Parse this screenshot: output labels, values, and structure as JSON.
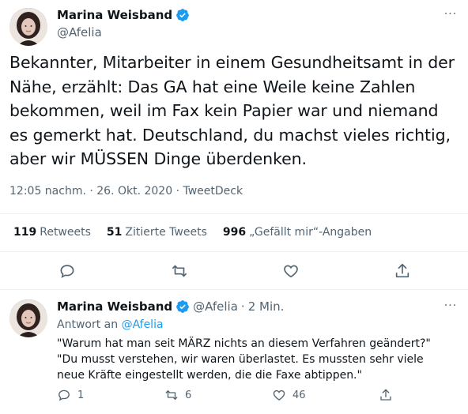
{
  "main_tweet": {
    "author_name": "Marina Weisband",
    "author_handle": "@Afelia",
    "text": "Bekannter, Mitarbeiter in einem Gesundheitsamt in der Nähe, erzählt: Das GA hat eine Weile keine Zahlen bekommen, weil im Fax kein Papier war und niemand es gemerkt hat. Deutschland, du machst vieles richtig, aber wir MÜSSEN Dinge überdenken.",
    "time": "12:05 nachm.",
    "date": "26. Okt. 2020",
    "source": "TweetDeck",
    "separator": "·",
    "stats": {
      "retweets_count": "119",
      "retweets_label": "Retweets",
      "quotes_count": "51",
      "quotes_label": "Zitierte Tweets",
      "likes_count": "996",
      "likes_label": "„Gefällt mir“-Angaben"
    },
    "more_label": "···"
  },
  "reply_tweet": {
    "author_name": "Marina Weisband",
    "author_handle": "@Afelia",
    "separator": "·",
    "time": "2 Min.",
    "reply_to_label": "Antwort an",
    "reply_to_handle": "@Afelia",
    "text": "\"Warum hat man seit MÄRZ nichts an diesem Verfahren geändert?\" \"Du musst verstehen, wir waren überlastet. Es mussten sehr viele neue Kräfte eingestellt werden, die die Faxe abtippen.\"",
    "reply_count": "1",
    "retweet_count": "6",
    "like_count": "46",
    "more_label": "···"
  },
  "colors": {
    "text_primary": "#0f1419",
    "text_secondary": "#536471",
    "accent_blue": "#1d9bf0",
    "divider": "#eff3f4"
  },
  "icons": {
    "verified": "verified-badge-icon",
    "reply": "reply-bubble-icon",
    "retweet": "retweet-arrows-icon",
    "like": "heart-icon",
    "share": "share-upload-icon",
    "more": "more-dots-icon"
  }
}
